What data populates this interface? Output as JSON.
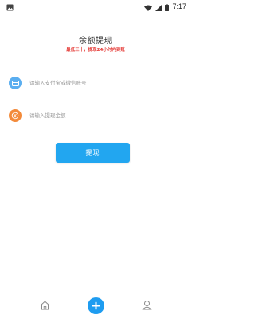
{
  "status_bar": {
    "time": "7:17",
    "icons": [
      "image-icon",
      "wifi-icon",
      "signal-icon",
      "battery-icon"
    ]
  },
  "page": {
    "title": "余额提现",
    "notice": "最低三十，提现24小时内到账"
  },
  "form": {
    "account": {
      "placeholder": "请输入支付宝或微信账号",
      "value": "",
      "icon": "card-icon",
      "icon_color": "#5aaef0"
    },
    "amount": {
      "placeholder": "请输入提现金额",
      "value": "",
      "icon": "coin-icon",
      "icon_color": "#f38a3a"
    },
    "submit_label": "提现"
  },
  "bottom_nav": {
    "items": [
      {
        "icon": "home-icon"
      },
      {
        "icon": "plus-icon"
      },
      {
        "icon": "profile-icon"
      }
    ]
  },
  "colors": {
    "accent": "#1e9cf0",
    "notice": "#e53935"
  }
}
